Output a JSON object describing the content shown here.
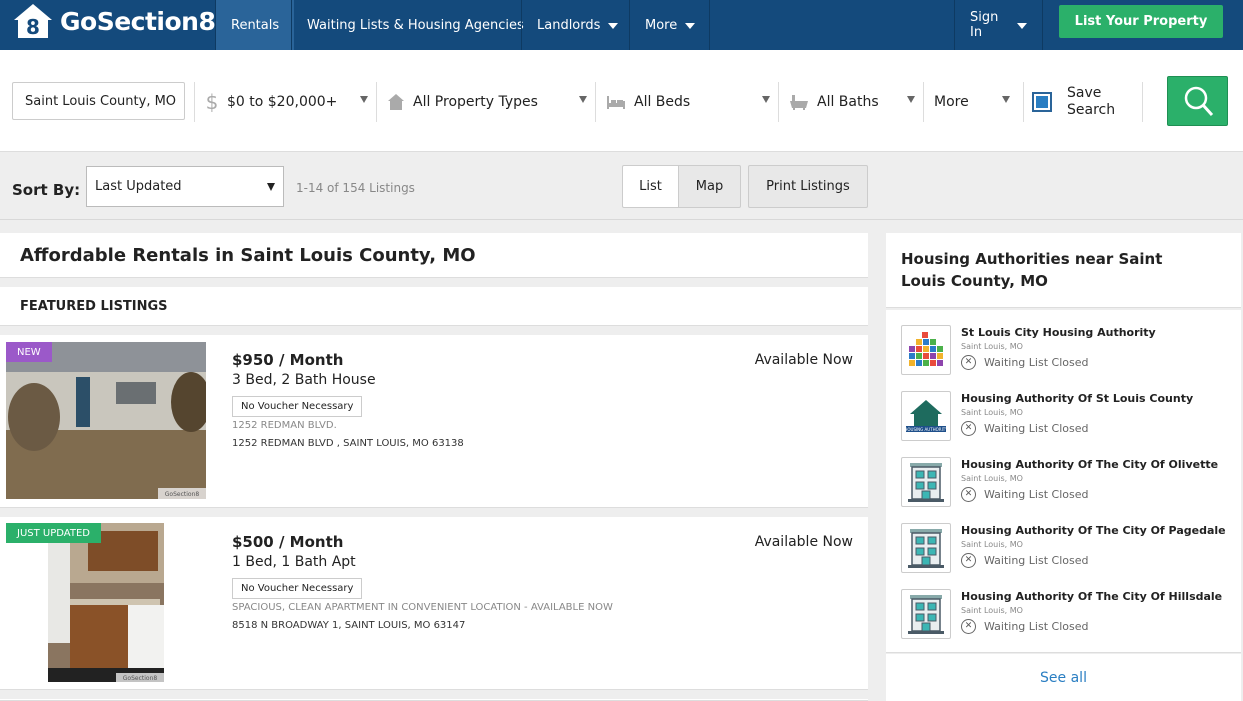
{
  "brand": {
    "name": "GoSection8"
  },
  "nav": {
    "rentals": "Rentals",
    "waiting_lists": "Waiting Lists & Housing Agencies",
    "landlords": "Landlords",
    "more": "More",
    "sign_in": "Sign In",
    "list_property": "List Your Property"
  },
  "filters": {
    "location": "Saint Louis County, MO",
    "price": "$0 to $20,000+",
    "property_type": "All Property Types",
    "beds": "All Beds",
    "baths": "All Baths",
    "more": "More",
    "save_search": "Save Search",
    "save_checked": true
  },
  "sort": {
    "label": "Sort By:",
    "value": "Last Updated",
    "count": "1-14 of 154 Listings"
  },
  "view": {
    "list": "List",
    "map": "Map",
    "print": "Print Listings"
  },
  "page": {
    "title": "Affordable Rentals in Saint Louis County, MO",
    "featured": "FEATURED LISTINGS"
  },
  "listings": [
    {
      "tag": "NEW",
      "tag_color": "#9b59c9",
      "price": "$950 / Month",
      "type": "3 Bed, 2 Bath House",
      "voucher": "No Voucher Necessary",
      "description": "1252 REDMAN BLVD.",
      "address": "1252 REDMAN BLVD , SAINT LOUIS, MO 63138",
      "availability": "Available Now"
    },
    {
      "tag": "JUST UPDATED",
      "tag_color": "#2bb06a",
      "price": "$500 / Month",
      "type": "1 Bed, 1 Bath Apt",
      "voucher": "No Voucher Necessary",
      "description": "SPACIOUS, CLEAN APARTMENT IN CONVENIENT LOCATION - AVAILABLE NOW",
      "address": "8518 N BROADWAY 1, SAINT LOUIS, MO 63147",
      "availability": "Available Now"
    }
  ],
  "sidebar": {
    "title": "Housing Authorities near Saint Louis County, MO",
    "authorities": [
      {
        "name": "St Louis City Housing Authority",
        "location": "Saint Louis, MO",
        "status": "Waiting List Closed",
        "icon": "colorful-grid-logo"
      },
      {
        "name": "Housing Authority Of St Louis County",
        "location": "Saint Louis, MO",
        "status": "Waiting List Closed",
        "icon": "house-logo"
      },
      {
        "name": "Housing Authority Of The City Of Olivette",
        "location": "Saint Louis, MO",
        "status": "Waiting List Closed",
        "icon": "building-icon"
      },
      {
        "name": "Housing Authority Of The City Of Pagedale",
        "location": "Saint Louis, MO",
        "status": "Waiting List Closed",
        "icon": "building-icon"
      },
      {
        "name": "Housing Authority Of The City Of Hillsdale",
        "location": "Saint Louis, MO",
        "status": "Waiting List Closed",
        "icon": "building-icon"
      }
    ],
    "see_all": "See all"
  },
  "colors": {
    "nav_bg": "#144a7c",
    "nav_active": "#2a6499",
    "cta_green": "#2bb06a",
    "link_blue": "#2a7ec2"
  }
}
